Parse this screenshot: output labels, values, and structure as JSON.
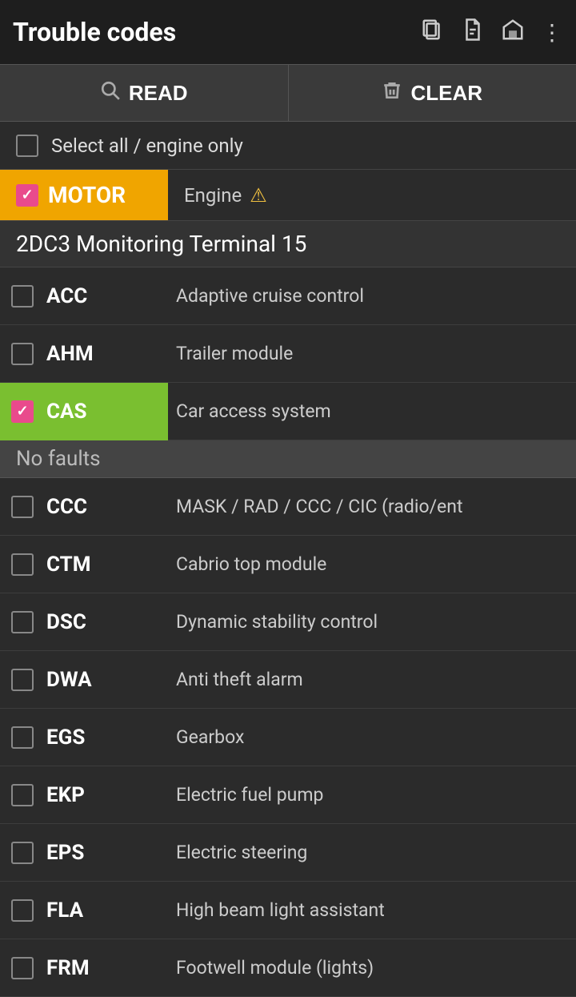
{
  "header": {
    "title": "Trouble codes",
    "icons": [
      "copy",
      "document",
      "home",
      "more"
    ]
  },
  "actions": {
    "read_label": "READ",
    "clear_label": "CLEAR"
  },
  "select_all": {
    "label": "Select all / engine only",
    "checked": false
  },
  "motor_section": {
    "badge_label": "MOTOR",
    "description": "Engine",
    "checked": true
  },
  "section_subtitle": "2DC3 Monitoring Terminal 15",
  "no_faults_label": "No faults",
  "items": [
    {
      "code": "ACC",
      "description": "Adaptive cruise control",
      "checked": false,
      "highlighted": false
    },
    {
      "code": "AHM",
      "description": "Trailer module",
      "checked": false,
      "highlighted": false
    },
    {
      "code": "CAS",
      "description": "Car access system",
      "checked": true,
      "highlighted": true
    },
    {
      "code": "CCC",
      "description": "MASK / RAD / CCC / CIC (radio/ent",
      "checked": false,
      "highlighted": false
    },
    {
      "code": "CTM",
      "description": "Cabrio top module",
      "checked": false,
      "highlighted": false
    },
    {
      "code": "DSC",
      "description": "Dynamic stability control",
      "checked": false,
      "highlighted": false
    },
    {
      "code": "DWA",
      "description": "Anti theft alarm",
      "checked": false,
      "highlighted": false
    },
    {
      "code": "EGS",
      "description": "Gearbox",
      "checked": false,
      "highlighted": false
    },
    {
      "code": "EKP",
      "description": "Electric fuel pump",
      "checked": false,
      "highlighted": false
    },
    {
      "code": "EPS",
      "description": "Electric steering",
      "checked": false,
      "highlighted": false
    },
    {
      "code": "FLA",
      "description": "High beam light assistant",
      "checked": false,
      "highlighted": false
    },
    {
      "code": "FRM",
      "description": "Footwell module (lights)",
      "checked": false,
      "highlighted": false
    }
  ]
}
